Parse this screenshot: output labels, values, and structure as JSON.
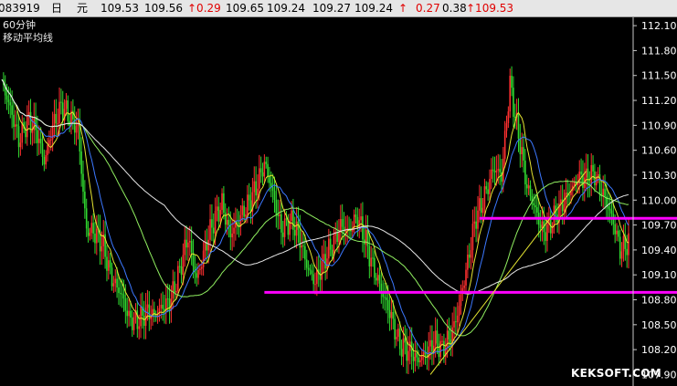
{
  "header": {
    "code": "083919",
    "period": "日",
    "unit": "元",
    "open": "109.53",
    "high_prev": "109.56",
    "change": "↑0.29",
    "v1": "109.65",
    "v2": "109.24",
    "v3": "109.27",
    "v4": "109.24",
    "arrow": "↑",
    "v5": "0.27",
    "v6": "0.38",
    "last": "↑109.53"
  },
  "plot_label": {
    "timeframe": "60分钟",
    "indicator": "移动平均线"
  },
  "watermark": "KEKSOFT.COM",
  "colors": {
    "background": "#000000",
    "up_candle": "#ff3030",
    "down_candle": "#30d830",
    "ma_yellow": "#e6e632",
    "ma_blue": "#3c78ff",
    "ma_green": "#90ee60",
    "ma_white": "#e8e8e8",
    "support_line": "#ff00ff",
    "axis_text": "#ffffff",
    "header_up": "#e00000"
  },
  "chart_data": {
    "type": "line",
    "description_series": "price",
    "y_ticks": [
      "112.10",
      "111.80",
      "111.50",
      "111.20",
      "110.90",
      "110.60",
      "110.30",
      "110.00",
      "109.70",
      "109.40",
      "109.10",
      "108.80",
      "108.50",
      "108.20",
      "107.90"
    ],
    "ylim": [
      107.85,
      112.2
    ],
    "n_bars": 230,
    "price_path": [
      [
        0,
        111.4
      ],
      [
        5,
        111.05
      ],
      [
        10,
        110.75
      ],
      [
        15,
        111.0
      ],
      [
        20,
        110.8
      ],
      [
        25,
        110.45
      ],
      [
        30,
        110.95
      ],
      [
        35,
        111.1
      ],
      [
        40,
        110.95
      ],
      [
        45,
        110.9
      ],
      [
        50,
        109.65
      ],
      [
        55,
        109.55
      ],
      [
        60,
        109.45
      ],
      [
        65,
        109.1
      ],
      [
        70,
        108.85
      ],
      [
        75,
        108.55
      ],
      [
        80,
        108.6
      ],
      [
        85,
        108.65
      ],
      [
        90,
        108.55
      ],
      [
        95,
        108.75
      ],
      [
        100,
        108.85
      ],
      [
        105,
        109.1
      ],
      [
        110,
        109.55
      ],
      [
        115,
        109.1
      ],
      [
        120,
        109.4
      ],
      [
        125,
        109.7
      ],
      [
        130,
        110.0
      ],
      [
        135,
        109.6
      ],
      [
        140,
        109.7
      ],
      [
        145,
        109.95
      ],
      [
        150,
        110.2
      ],
      [
        155,
        110.4
      ],
      [
        160,
        110.05
      ],
      [
        165,
        109.7
      ],
      [
        170,
        109.75
      ],
      [
        175,
        109.55
      ],
      [
        180,
        109.25
      ],
      [
        185,
        109.05
      ],
      [
        190,
        109.2
      ],
      [
        195,
        109.45
      ],
      [
        200,
        109.75
      ],
      [
        205,
        109.6
      ],
      [
        210,
        109.75
      ],
      [
        215,
        109.55
      ],
      [
        220,
        109.15
      ],
      [
        225,
        108.8
      ],
      [
        230,
        108.6
      ],
      [
        235,
        108.3
      ],
      [
        240,
        108.15
      ],
      [
        245,
        108.05
      ],
      [
        250,
        108.2
      ],
      [
        255,
        108.3
      ],
      [
        260,
        108.15
      ],
      [
        265,
        108.4
      ],
      [
        270,
        108.75
      ],
      [
        275,
        109.2
      ],
      [
        280,
        109.8
      ],
      [
        285,
        110.1
      ],
      [
        290,
        110.35
      ],
      [
        295,
        110.25
      ],
      [
        300,
        111.45
      ],
      [
        305,
        110.8
      ],
      [
        310,
        110.1
      ],
      [
        315,
        109.9
      ],
      [
        320,
        109.65
      ],
      [
        325,
        109.7
      ],
      [
        330,
        109.9
      ],
      [
        335,
        110.15
      ],
      [
        340,
        110.25
      ],
      [
        345,
        110.2
      ],
      [
        350,
        110.35
      ],
      [
        355,
        110.1
      ],
      [
        360,
        109.75
      ],
      [
        365,
        109.4
      ],
      [
        370,
        109.55
      ]
    ],
    "moving_averages": [
      {
        "color_key": "ma_yellow",
        "period": 5
      },
      {
        "color_key": "ma_blue",
        "period": 10
      },
      {
        "color_key": "ma_green",
        "period": 30
      },
      {
        "color_key": "ma_white",
        "period": 60
      }
    ],
    "annotations": [
      {
        "type": "hline",
        "color_key": "support_line",
        "y": 108.89,
        "x_from_index": 155,
        "x_to_index": 370
      },
      {
        "type": "hline",
        "color_key": "support_line",
        "y": 109.78,
        "x_from_index": 282,
        "x_to_index": 370
      },
      {
        "type": "trendline",
        "color_key": "ma_yellow",
        "from": [
          253,
          107.9
        ],
        "to": [
          345,
          110.35
        ]
      }
    ],
    "grid": false,
    "legend": "none"
  }
}
